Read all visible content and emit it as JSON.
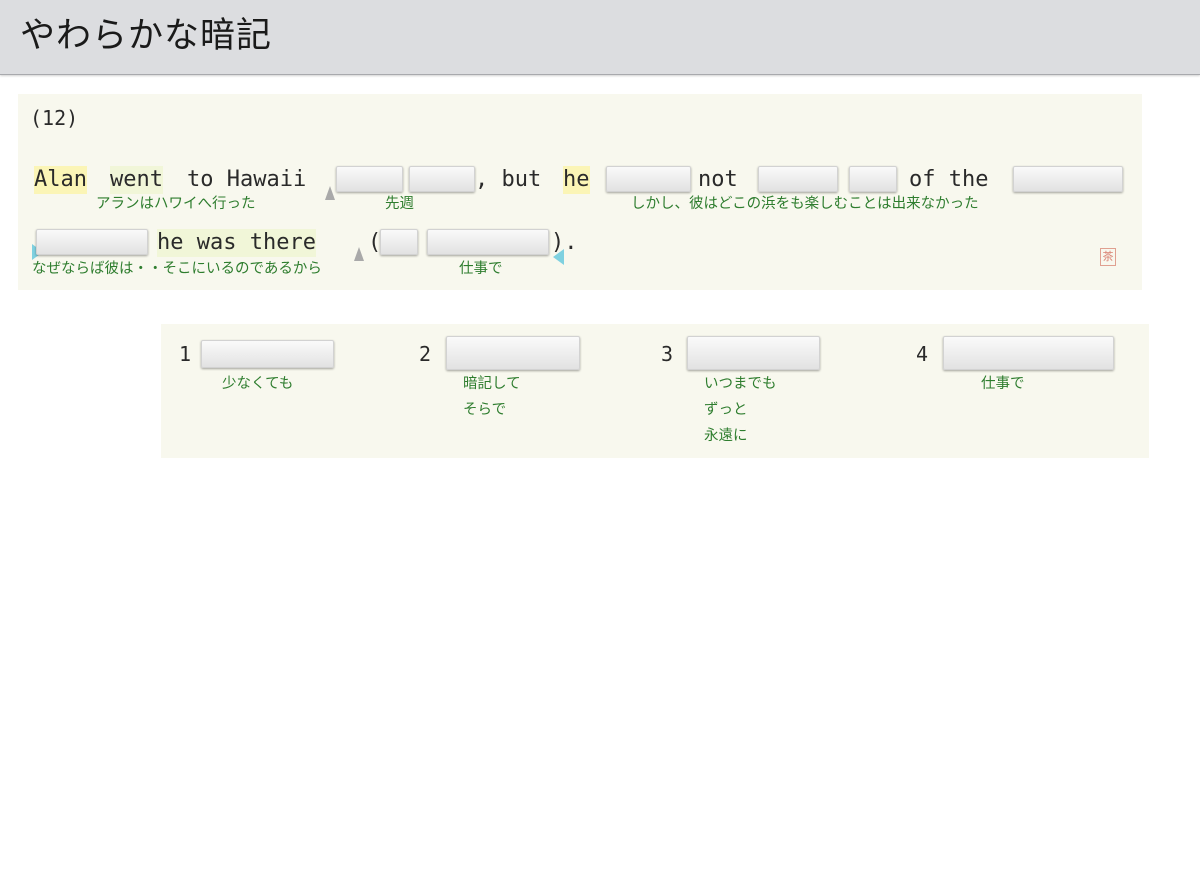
{
  "app": {
    "title": "やわらかな暗記"
  },
  "question": {
    "number": "(12)",
    "line1": {
      "w_alan": "Alan",
      "w_went": "went",
      "w_to_hawaii": "to Hawaii",
      "w_but": ", but",
      "w_he": "he",
      "w_not": "not",
      "w_of_the": "of the"
    },
    "line2": {
      "w_he_was_there": "he was there",
      "w_open_paren": "(",
      "w_close_paren": ")."
    },
    "glosses": {
      "g1": "アランはハワイへ行った",
      "g2": "先週",
      "g3": "しかし、彼はどこの浜をも楽しむことは出来なかった",
      "g4": "なぜならば彼は・・そこにいるのであるから",
      "g5": "仕事で"
    },
    "seal_char": "茶"
  },
  "answers": [
    {
      "num": "1",
      "options": [
        "少なくても"
      ]
    },
    {
      "num": "2",
      "options": [
        "暗記して",
        "そらで"
      ]
    },
    {
      "num": "3",
      "options": [
        "いつまでも",
        "ずっと",
        "永遠に"
      ]
    },
    {
      "num": "4",
      "options": [
        "仕事で"
      ]
    }
  ],
  "colors": {
    "highlight": "#fbf5b6",
    "gloss_text": "#2e7d2e",
    "panel_bg": "#f8f8ee",
    "header_bg": "#dcdde0"
  }
}
